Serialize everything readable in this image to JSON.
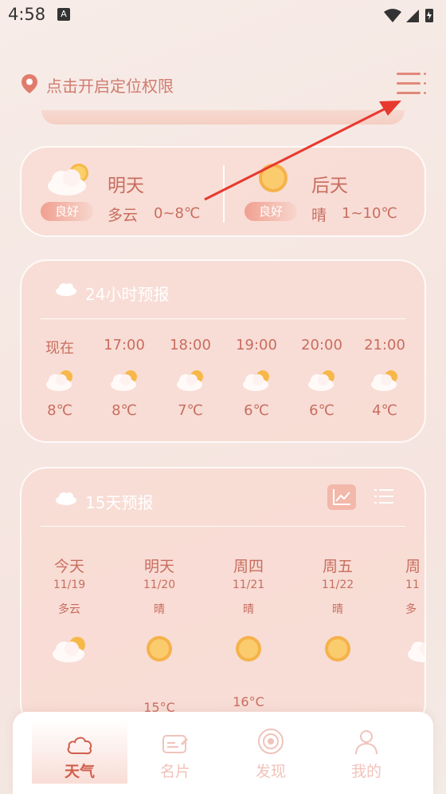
{
  "status_bar": {
    "time": "4:58",
    "notif_letter": "A"
  },
  "header": {
    "location_text": "点击开启定位权限"
  },
  "forecast": {
    "tomorrow": {
      "day": "明天",
      "quality": "良好",
      "condition": "多云",
      "temp": "0~8℃",
      "icon": "partly-cloudy-icon"
    },
    "after_tomorrow": {
      "day": "后天",
      "quality": "良好",
      "condition": "晴",
      "temp": "1~10℃",
      "icon": "sun-icon"
    }
  },
  "hourly": {
    "title": "24小时预报",
    "items": [
      {
        "time": "现在",
        "temp": "8℃"
      },
      {
        "time": "17:00",
        "temp": "8℃"
      },
      {
        "time": "18:00",
        "temp": "7℃"
      },
      {
        "time": "19:00",
        "temp": "6℃"
      },
      {
        "time": "20:00",
        "temp": "6℃"
      },
      {
        "time": "21:00",
        "temp": "4℃"
      }
    ]
  },
  "daily": {
    "title": "15天预报",
    "items": [
      {
        "day": "今天",
        "date": "11/19",
        "condition": "多云",
        "icon": "partly-cloudy-icon",
        "high": ""
      },
      {
        "day": "明天",
        "date": "11/20",
        "condition": "晴",
        "icon": "sun-icon",
        "high": "15°C"
      },
      {
        "day": "周四",
        "date": "11/21",
        "condition": "晴",
        "icon": "sun-icon",
        "high": "16°C"
      },
      {
        "day": "周五",
        "date": "11/22",
        "condition": "晴",
        "icon": "sun-icon",
        "high": ""
      },
      {
        "day": "周",
        "date": "11",
        "condition": "多",
        "icon": "partly-cloudy-icon",
        "high": ""
      }
    ]
  },
  "nav": {
    "items": [
      {
        "label": "天气",
        "icon": "cloud-icon",
        "active": true
      },
      {
        "label": "名片",
        "icon": "card-icon",
        "active": false
      },
      {
        "label": "发现",
        "icon": "discover-icon",
        "active": false
      },
      {
        "label": "我的",
        "icon": "user-icon",
        "active": false
      }
    ]
  },
  "colors": {
    "accent": "#d0604e",
    "text": "#c86d5f",
    "annotation": "#e8392f"
  }
}
